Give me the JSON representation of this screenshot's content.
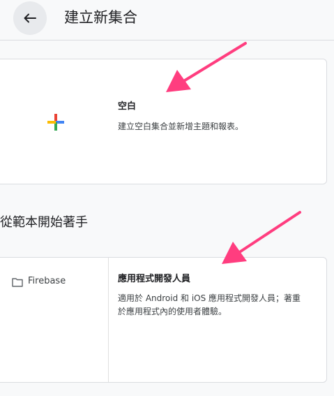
{
  "header": {
    "title": "建立新集合",
    "back_icon": "arrow-left-icon"
  },
  "blank_option": {
    "icon": "plus-icon",
    "title": "空白",
    "description": "建立空白集合並新增主題和報表。"
  },
  "templates_section": {
    "title": "從範本開始著手"
  },
  "template_option": {
    "folder_icon": "folder-icon",
    "folder_label": "Firebase",
    "title": "應用程式開發人員",
    "description_line1": "適用於 Android 和 iOS 應用程式開發人員；著重",
    "description_line2": "於應用程式內的使用者體驗。"
  },
  "colors": {
    "annotation_arrow": "#ff3d7f",
    "google_blue": "#4285f4",
    "google_red": "#ea4335",
    "google_yellow": "#fbbc04",
    "google_green": "#34a853"
  }
}
